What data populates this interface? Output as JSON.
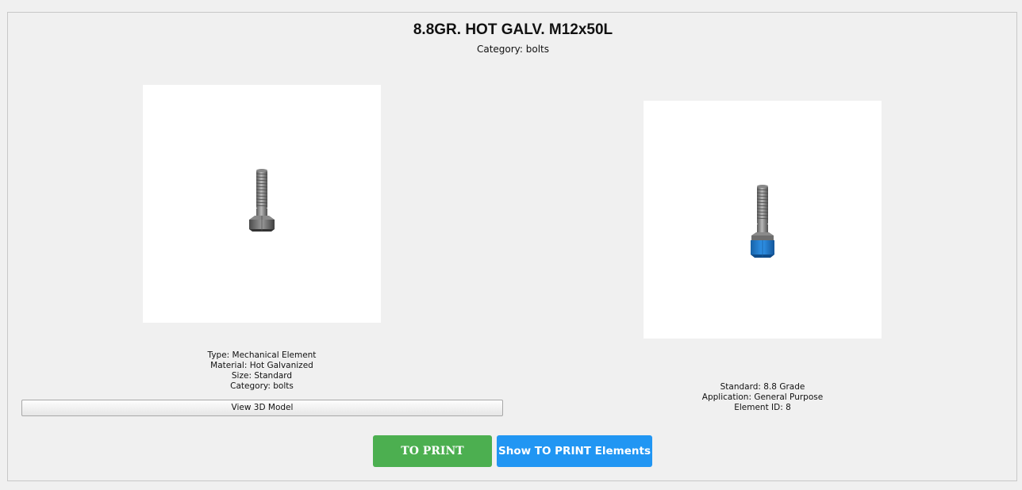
{
  "product": {
    "title": "8.8GR. HOT GALV. M12x50L",
    "category_line": "Category: bolts"
  },
  "left_panel": {
    "image": "bolt-3d-render",
    "details": [
      "Type: Mechanical Element",
      "Material: Hot Galvanized",
      "Size: Standard",
      "Category: bolts"
    ],
    "view_button_label": "View 3D Model"
  },
  "right_panel": {
    "image": "bolt-with-highlighted-nut-render",
    "highlight_color": "#1e7fd6",
    "details": [
      "Standard: 8.8 Grade",
      "Application: General Purpose",
      "Element ID: 8"
    ]
  },
  "actions": {
    "print_label": "TO PRINT",
    "print_color": "#4caf50",
    "show_label": "Show TO PRINT Elements",
    "show_color": "#2196f3"
  }
}
